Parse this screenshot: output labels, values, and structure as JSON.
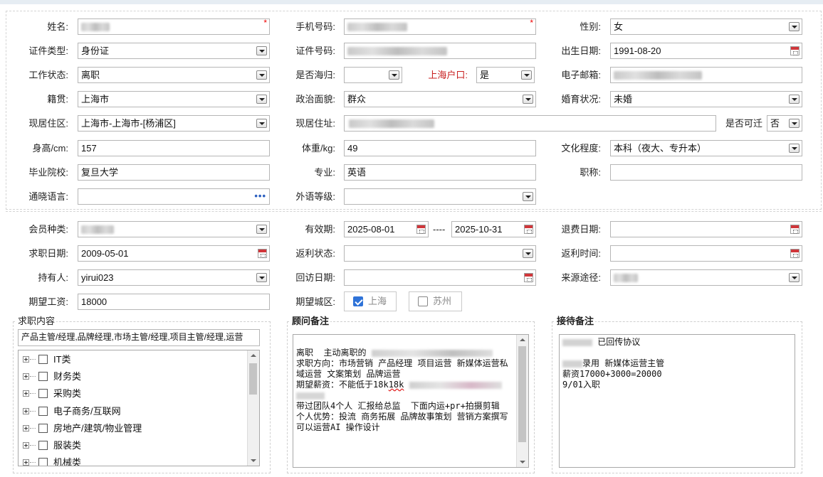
{
  "form": {
    "name_label": "姓名:",
    "phone_label": "手机号码:",
    "gender_label": "性别:",
    "gender_value": "女",
    "id_type_label": "证件类型:",
    "id_type_value": "身份证",
    "id_no_label": "证件号码:",
    "birth_label": "出生日期:",
    "birth_value": "1991-08-20",
    "work_status_label": "工作状态:",
    "work_status_value": "离职",
    "overseas_label": "是否海归:",
    "overseas_value": "",
    "shanghai_hukou_label": "上海户口:",
    "shanghai_hukou_value": "是",
    "email_label": "电子邮箱:",
    "native_label": "籍贯:",
    "native_value": "上海市",
    "political_label": "政治面貌:",
    "political_value": "群众",
    "marital_label": "婚育状况:",
    "marital_value": "未婚",
    "residence_area_label": "现居住区:",
    "residence_area_value": "上海市-上海市-[杨浦区]",
    "residence_addr_label": "现居住址:",
    "relocate_label": "是否可迁",
    "relocate_value": "否",
    "height_label": "身高/cm:",
    "height_value": "157",
    "weight_label": "体重/kg:",
    "weight_value": "49",
    "education_label": "文化程度:",
    "education_value": "本科（夜大、专升本）",
    "school_label": "毕业院校:",
    "school_value": "复旦大学",
    "major_label": "专业:",
    "major_value": "英语",
    "title_label": "职称:",
    "title_value": "",
    "language_label": "通晓语言:",
    "language_value": "",
    "language_more": "•••",
    "foreign_level_label": "外语等级:",
    "foreign_level_value": ""
  },
  "member": {
    "member_type_label": "会员种类:",
    "valid_label": "有效期:",
    "valid_from": "2025-08-01",
    "valid_sep": "----",
    "valid_to": "2025-10-31",
    "refund_date_label": "退费日期:",
    "refund_date_value": "",
    "job_date_label": "求职日期:",
    "job_date_value": "2009-05-01",
    "rebate_status_label": "返利状态:",
    "rebate_status_value": "",
    "rebate_time_label": "返利时间:",
    "rebate_time_value": "",
    "holder_label": "持有人:",
    "holder_value": "yirui023",
    "revisit_label": "回访日期:",
    "revisit_value": "",
    "source_label": "来源途径:",
    "salary_label": "期望工资:",
    "salary_value": "18000",
    "city_label": "期望城区:",
    "cities": [
      {
        "label": "上海",
        "checked": true
      },
      {
        "label": "苏州",
        "checked": false
      }
    ]
  },
  "job_content": {
    "legend": "求职内容",
    "summary": "产品主管/经理,品牌经理,市场主管/经理,项目主管/经理,运营",
    "tree": [
      "IT类",
      "财务类",
      "采购类",
      "电子商务/互联网",
      "房地产/建筑/物业管理",
      "服装类",
      "机械类"
    ]
  },
  "advisor_notes": {
    "legend": "顾问备注",
    "lines": [
      "离职  主动离职的",
      "求职方向：市场营销 产品经理 项目运营 新媒体运营私域运营 文案策划 品牌运营",
      "期望薪资：不能低于18k",
      "",
      "带过团队4个人 汇报给总监  下面内运+pr+拍摄剪辑",
      "个人优势：投流 商务拓展 品牌故事策划 营销方案撰写 可以运营AI 操作设计"
    ],
    "underline_word": "18k"
  },
  "reception_notes": {
    "legend": "接待备注",
    "line1": "已回传协议",
    "line2": "录用 新媒体运营主管",
    "line3": "薪资17000+3000=20000",
    "line4": "9/01入职"
  }
}
